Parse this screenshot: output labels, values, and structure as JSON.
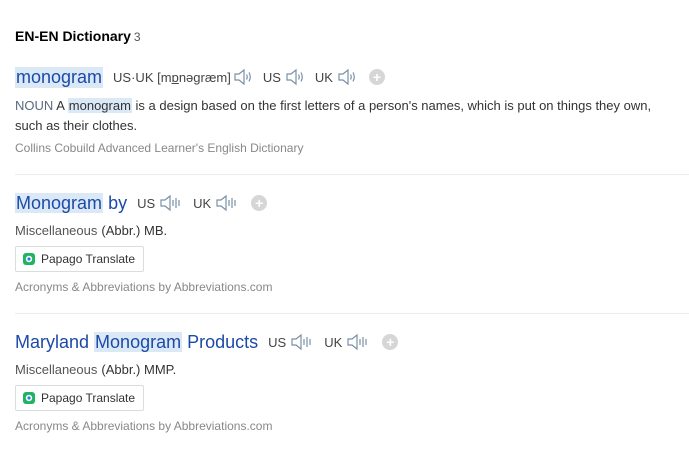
{
  "section": {
    "title": "EN-EN Dictionary",
    "count": "3"
  },
  "entries": [
    {
      "word": "monogram",
      "pron": {
        "usuk_label": "US·UK",
        "ipa_left": "[m",
        "ipa_mid": "ɒ",
        "ipa_right": "nəgræm]",
        "us_label": "US",
        "uk_label": "UK"
      },
      "definition": {
        "pos": "NOUN",
        "pre": "A",
        "hl": "monogram",
        "post": "is a design based on the first letters of a person's names, which is put on things they own, such as their clothes."
      },
      "source": "Collins Cobuild Advanced Learner's English Dictionary"
    },
    {
      "word_hl": "Monogram",
      "word_rest": "by",
      "pron": {
        "us_label": "US",
        "uk_label": "UK"
      },
      "category": "Miscellaneous",
      "abbr": "(Abbr.) MB.",
      "translate_label": "Papago Translate",
      "source": "Acronyms & Abbreviations by Abbreviations.com"
    },
    {
      "word_pre": "Maryland",
      "word_hl": "Monogram",
      "word_post": "Products",
      "pron": {
        "us_label": "US",
        "uk_label": "UK"
      },
      "category": "Miscellaneous",
      "abbr": "(Abbr.) MMP.",
      "translate_label": "Papago Translate",
      "source": "Acronyms & Abbreviations by Abbreviations.com"
    }
  ],
  "icons": {
    "speaker": "speaker-icon",
    "add": "add-icon",
    "papago": "papago-icon"
  },
  "colors": {
    "word": "#1c4aa8",
    "highlight": "#dbe9f6"
  }
}
